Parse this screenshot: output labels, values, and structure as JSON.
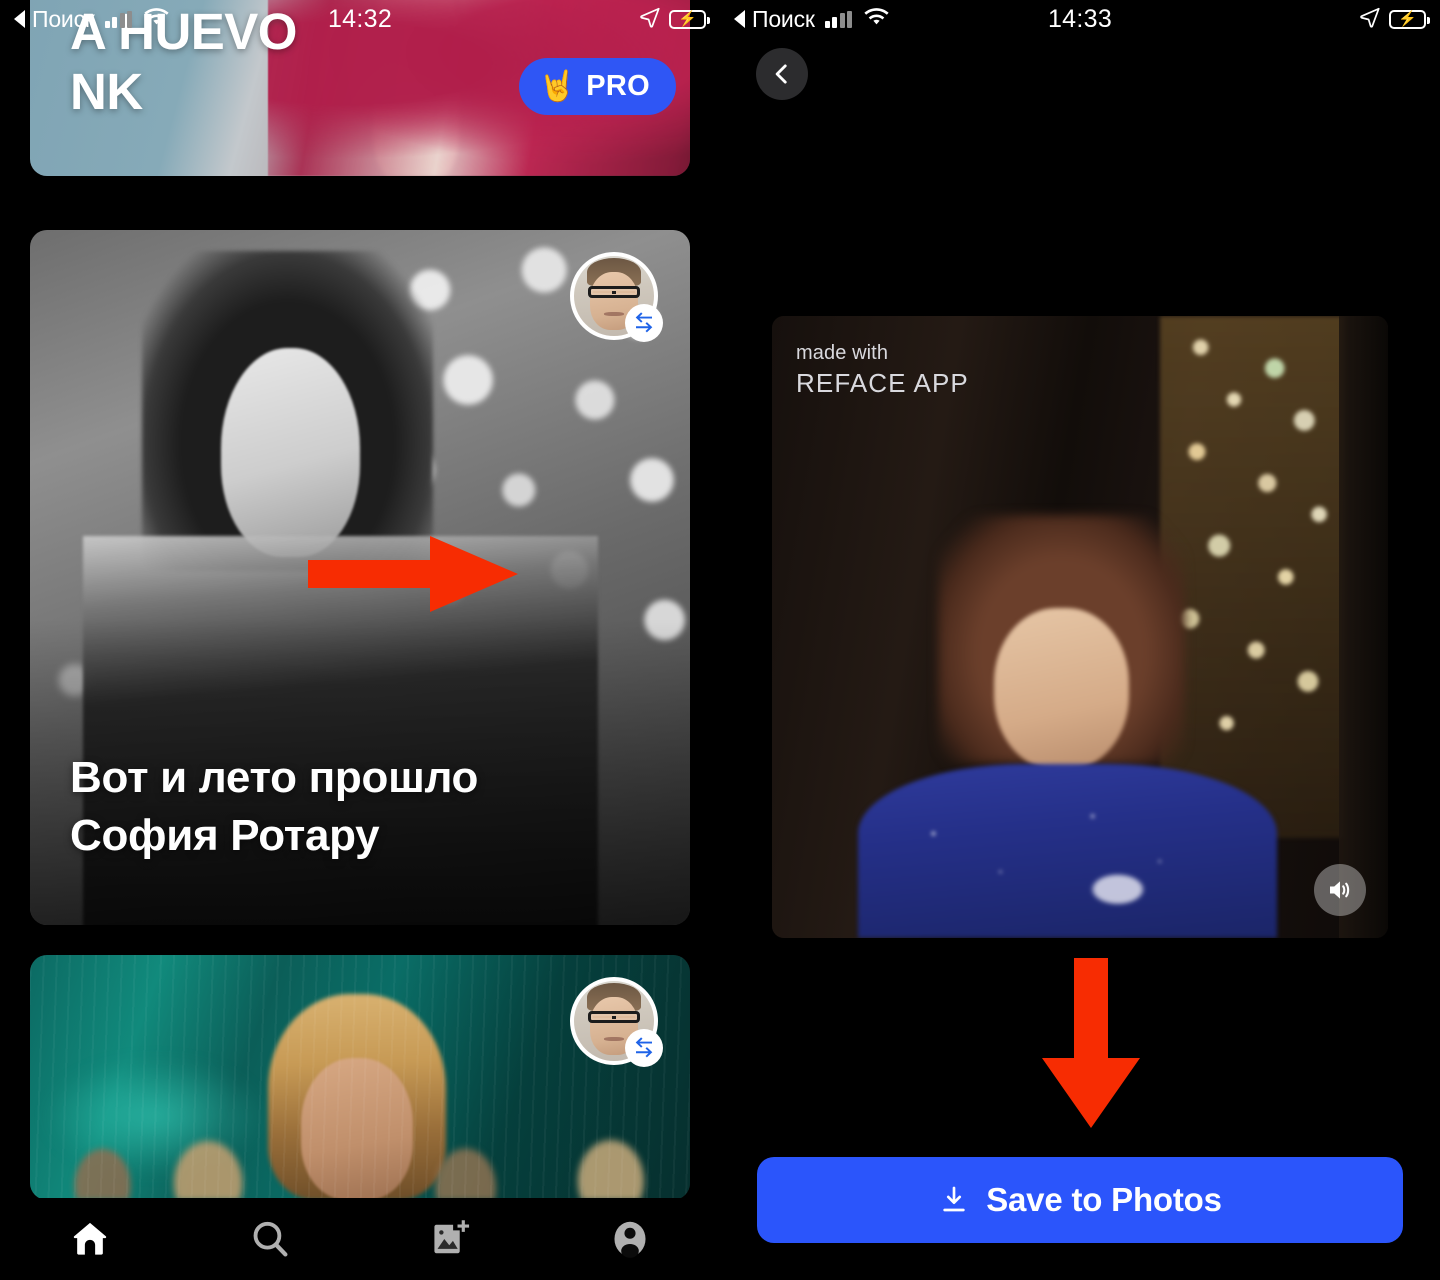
{
  "left_screen": {
    "status_bar": {
      "back_app": "Поиск",
      "time": "14:32",
      "battery_state": "charging"
    },
    "pro_button": {
      "label": "PRO",
      "icon": "🤘"
    },
    "cards": [
      {
        "id": "card-top",
        "title_lines": [
          "A HUEVO",
          "NK"
        ],
        "avatar_badge": false
      },
      {
        "id": "card-mid",
        "title_lines": [
          "Вот и лето прошло",
          "София Ротару"
        ],
        "avatar_badge": true
      },
      {
        "id": "card-bot",
        "title_lines": [],
        "avatar_badge": true
      }
    ],
    "tabbar": {
      "items": [
        {
          "name": "home",
          "icon": "home-icon",
          "active": true
        },
        {
          "name": "search",
          "icon": "search-icon",
          "active": false
        },
        {
          "name": "add-photo",
          "icon": "add-photo-icon",
          "active": false
        },
        {
          "name": "profile",
          "icon": "profile-icon",
          "active": false
        }
      ]
    }
  },
  "right_screen": {
    "status_bar": {
      "back_app": "Поиск",
      "time": "14:33",
      "battery_state": "charging"
    },
    "back_button": {
      "icon": "chevron-left-icon"
    },
    "video": {
      "watermark_small": "made with",
      "watermark_big": "REFACE APP",
      "volume_icon": "volume-on-icon"
    },
    "save_button": {
      "label": "Save to Photos",
      "icon": "download-icon"
    }
  },
  "annotations": {
    "arrow_right": {
      "direction": "right",
      "color": "#f72c02"
    },
    "arrow_down": {
      "direction": "down",
      "color": "#f72c02"
    }
  },
  "colors": {
    "accent_blue": "#2b55fb",
    "annotation_red": "#f72c02",
    "background": "#000000",
    "battery_green": "#3bd24b"
  }
}
